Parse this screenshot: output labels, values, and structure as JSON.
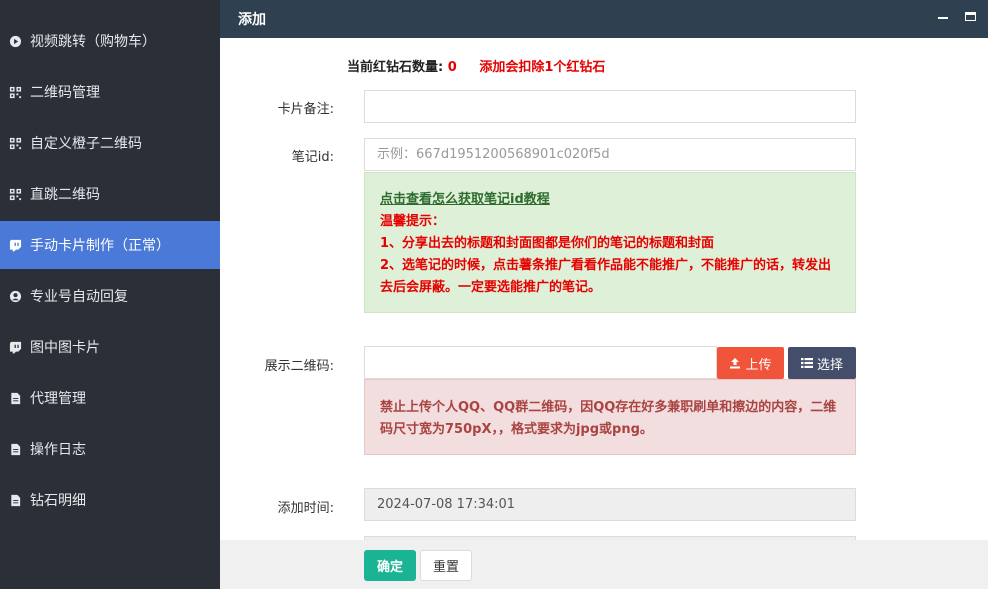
{
  "sidebar": {
    "items": [
      {
        "label": "视频跳转（购物车）",
        "icon": "play-circle-icon",
        "active": false
      },
      {
        "label": "二维码管理",
        "icon": "qrcode-icon",
        "active": false
      },
      {
        "label": "自定义橙子二维码",
        "icon": "qrcode-icon",
        "active": false
      },
      {
        "label": "直跳二维码",
        "icon": "qrcode-icon",
        "active": false
      },
      {
        "label": "手动卡片制作（正常）",
        "icon": "twitch-icon",
        "active": true
      },
      {
        "label": "专业号自动回复",
        "icon": "user-circle-icon",
        "active": false
      },
      {
        "label": "图中图卡片",
        "icon": "twitch-icon",
        "active": false
      },
      {
        "label": "代理管理",
        "icon": "file-icon",
        "active": false
      },
      {
        "label": "操作日志",
        "icon": "file-icon",
        "active": false
      },
      {
        "label": "钻石明细",
        "icon": "file-icon",
        "active": false
      }
    ]
  },
  "dialog": {
    "title": "添加",
    "info": {
      "label": "当前红钻石数量:",
      "count": "0",
      "warning": "添加会扣除1个红钻石"
    },
    "card_note": {
      "label": "卡片备注:",
      "value": ""
    },
    "note_id": {
      "label": "笔记id:",
      "placeholder": "示例：667d1951200568901c020f5d"
    },
    "green_tip": {
      "link": "点击查看怎么获取笔记id教程",
      "title": "温馨提示：",
      "line1": "1、分享出去的标题和封面图都是你们的笔记的标题和封面",
      "line2": "2、选笔记的时候，点击薯条推广看看作品能不能推广，不能推广的话，转发出去后会屏蔽。一定要选能推广的笔记。"
    },
    "qr": {
      "label": "展示二维码:",
      "upload": "上传",
      "choose": "选择"
    },
    "red_tip": "禁止上传个人QQ、QQ群二维码，因QQ存在好多兼职刷单和擦边的内容，二维码尺寸宽为750pX，，格式要求为jpg或png。",
    "add_time": {
      "label": "添加时间:",
      "value": "2024-07-08 17:34:01"
    },
    "buttons": {
      "ok": "确定",
      "reset": "重置"
    }
  },
  "colors": {
    "sidebar_bg": "#2b3038",
    "active_bg": "#4a79d8",
    "header_bg": "#2f4050",
    "upload_btn": "#f0553c",
    "choose_btn": "#444d6a",
    "ok_btn": "#1ab394"
  }
}
